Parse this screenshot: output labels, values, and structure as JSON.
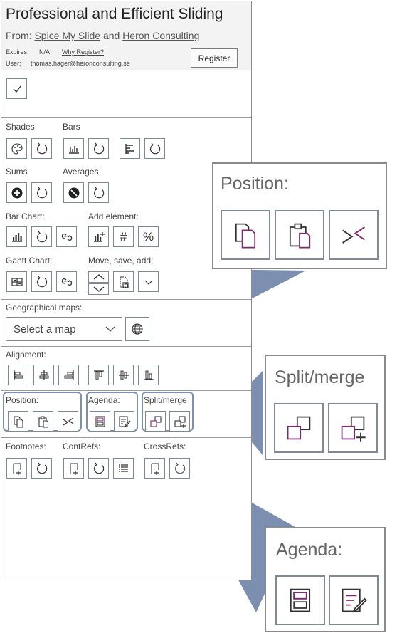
{
  "header": {
    "title": "Professional and Efficient Sliding",
    "from_label": "From:",
    "from_company1": "Spice My Slide",
    "and_text": "and",
    "from_company2": "Heron Consulting",
    "expires_label": "Expires:",
    "expires_value": "N/A",
    "why_register": "Why Register?",
    "user_label": "User:",
    "user_value": "thomas.hager@heronconsulting.se",
    "register_button": "Register"
  },
  "sections": {
    "shades": "Shades",
    "bars": "Bars",
    "sums": "Sums",
    "averages": "Averages",
    "bar_chart": "Bar Chart:",
    "add_element": "Add element:",
    "gantt_chart": "Gantt Chart:",
    "move_save_add": "Move, save, add:",
    "geo_maps": "Geographical maps:",
    "select_map": "Select a map",
    "alignment": "Alignment:",
    "position": "Position:",
    "agenda": "Agenda:",
    "split_merge": "Split/merge",
    "footnotes": "Footnotes:",
    "contrefs": "ContRefs:",
    "crossrefs": "CrossRefs:",
    "hash_symbol": "#",
    "percent_symbol": "%"
  },
  "zoom": {
    "position_label": "Position:",
    "split_merge_label": "Split/merge",
    "agenda_label": "Agenda:"
  },
  "colors": {
    "callout_fill": "#7d8fb1",
    "icon_stroke": "#333333",
    "accent_purple": "#7b2c6e"
  },
  "icons": [
    "check-icon",
    "palette-icon",
    "refresh-icon",
    "bar-chart-icon",
    "align-bars-icon",
    "plus-circle-icon",
    "no-circle-icon",
    "link-icon",
    "add-bar-icon",
    "hash-icon",
    "percent-icon",
    "gantt-icon",
    "up-chevron-icon",
    "down-chevron-icon",
    "save-icon",
    "chevron-down-icon",
    "globe-icon",
    "align-left-icon",
    "align-center-icon",
    "align-right-icon",
    "align-top-icon",
    "align-middle-icon",
    "align-bottom-icon",
    "copy-icon",
    "paste-icon",
    "swap-icon",
    "agenda-icon",
    "agenda-edit-icon",
    "split-icon",
    "merge-icon",
    "footnote-icon",
    "list-icon"
  ]
}
